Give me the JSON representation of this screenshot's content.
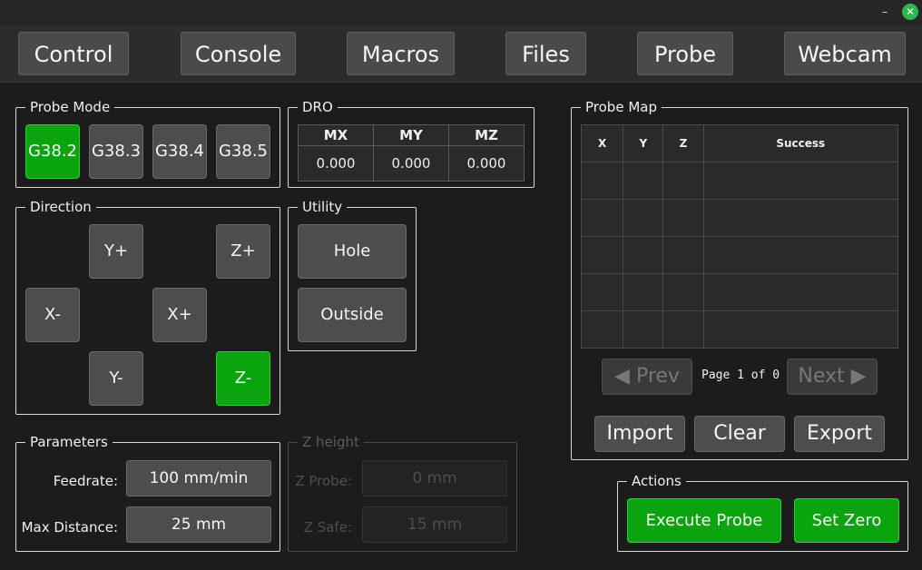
{
  "window": {
    "minimize": "–",
    "close": "✕"
  },
  "tabs": [
    "Control",
    "Console",
    "Macros",
    "Files",
    "Probe",
    "Webcam"
  ],
  "probe_mode": {
    "title": "Probe Mode",
    "buttons": [
      "G38.2",
      "G38.3",
      "G38.4",
      "G38.5"
    ],
    "active": "G38.2"
  },
  "dro": {
    "title": "DRO",
    "headers": [
      "MX",
      "MY",
      "MZ"
    ],
    "values": [
      "0.000",
      "0.000",
      "0.000"
    ]
  },
  "direction": {
    "title": "Direction",
    "y_plus": "Y+",
    "z_plus": "Z+",
    "x_minus": "X-",
    "x_plus": "X+",
    "y_minus": "Y-",
    "z_minus": "Z-",
    "active": "Z-"
  },
  "utility": {
    "title": "Utility",
    "hole": "Hole",
    "outside": "Outside"
  },
  "parameters": {
    "title": "Parameters",
    "feedrate_label": "Feedrate:",
    "feedrate_value": "100 mm/min",
    "max_distance_label": "Max Distance:",
    "max_distance_value": "25 mm"
  },
  "z_height": {
    "title": "Z height",
    "z_probe_label": "Z Probe:",
    "z_probe_value": "0 mm",
    "z_safe_label": "Z Safe:",
    "z_safe_value": "15 mm",
    "enabled": false
  },
  "probe_map": {
    "title": "Probe Map",
    "headers": [
      "X",
      "Y",
      "Z",
      "Success"
    ],
    "rows": [
      [
        "",
        "",
        "",
        ""
      ],
      [
        "",
        "",
        "",
        ""
      ],
      [
        "",
        "",
        "",
        ""
      ],
      [
        "",
        "",
        "",
        ""
      ],
      [
        "",
        "",
        "",
        ""
      ]
    ],
    "prev": "◀ Prev",
    "next": "Next ▶",
    "page_text": "Page 1 of 0",
    "import": "Import",
    "clear": "Clear",
    "export": "Export"
  },
  "actions": {
    "title": "Actions",
    "execute": "Execute Probe",
    "set_zero": "Set Zero"
  },
  "colors": {
    "accent_green": "#0aa50e",
    "background": "#1c1c1c",
    "button": "#4d4d4d"
  }
}
